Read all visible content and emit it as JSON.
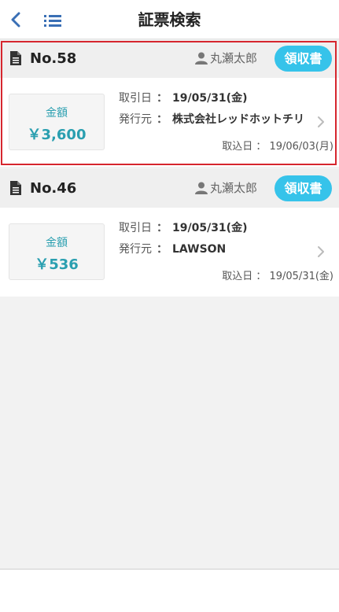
{
  "header": {
    "title": "証票検索",
    "back_icon": "chevron-left-icon",
    "menu_icon": "list-icon"
  },
  "accent_color": "#36c3ea",
  "selection_color": "#d6262e",
  "cards": [
    {
      "number": "No.58",
      "user": "丸瀬太郎",
      "receipt_label": "領収書",
      "amount_label": "金額",
      "amount": "￥3,600",
      "trade_date_label": "取引日",
      "trade_date": "19/05/31(金)",
      "issuer_label": "発行元",
      "issuer": "株式会社レッドホットチリ",
      "import_label": "取込日",
      "import_date": "19/06/03(月)",
      "selected": true
    },
    {
      "number": "No.46",
      "user": "丸瀬太郎",
      "receipt_label": "領収書",
      "amount_label": "金額",
      "amount": "￥536",
      "trade_date_label": "取引日",
      "trade_date": "19/05/31(金)",
      "issuer_label": "発行元",
      "issuer": "LAWSON",
      "import_label": "取込日",
      "import_date": "19/05/31(金)",
      "selected": false
    }
  ]
}
